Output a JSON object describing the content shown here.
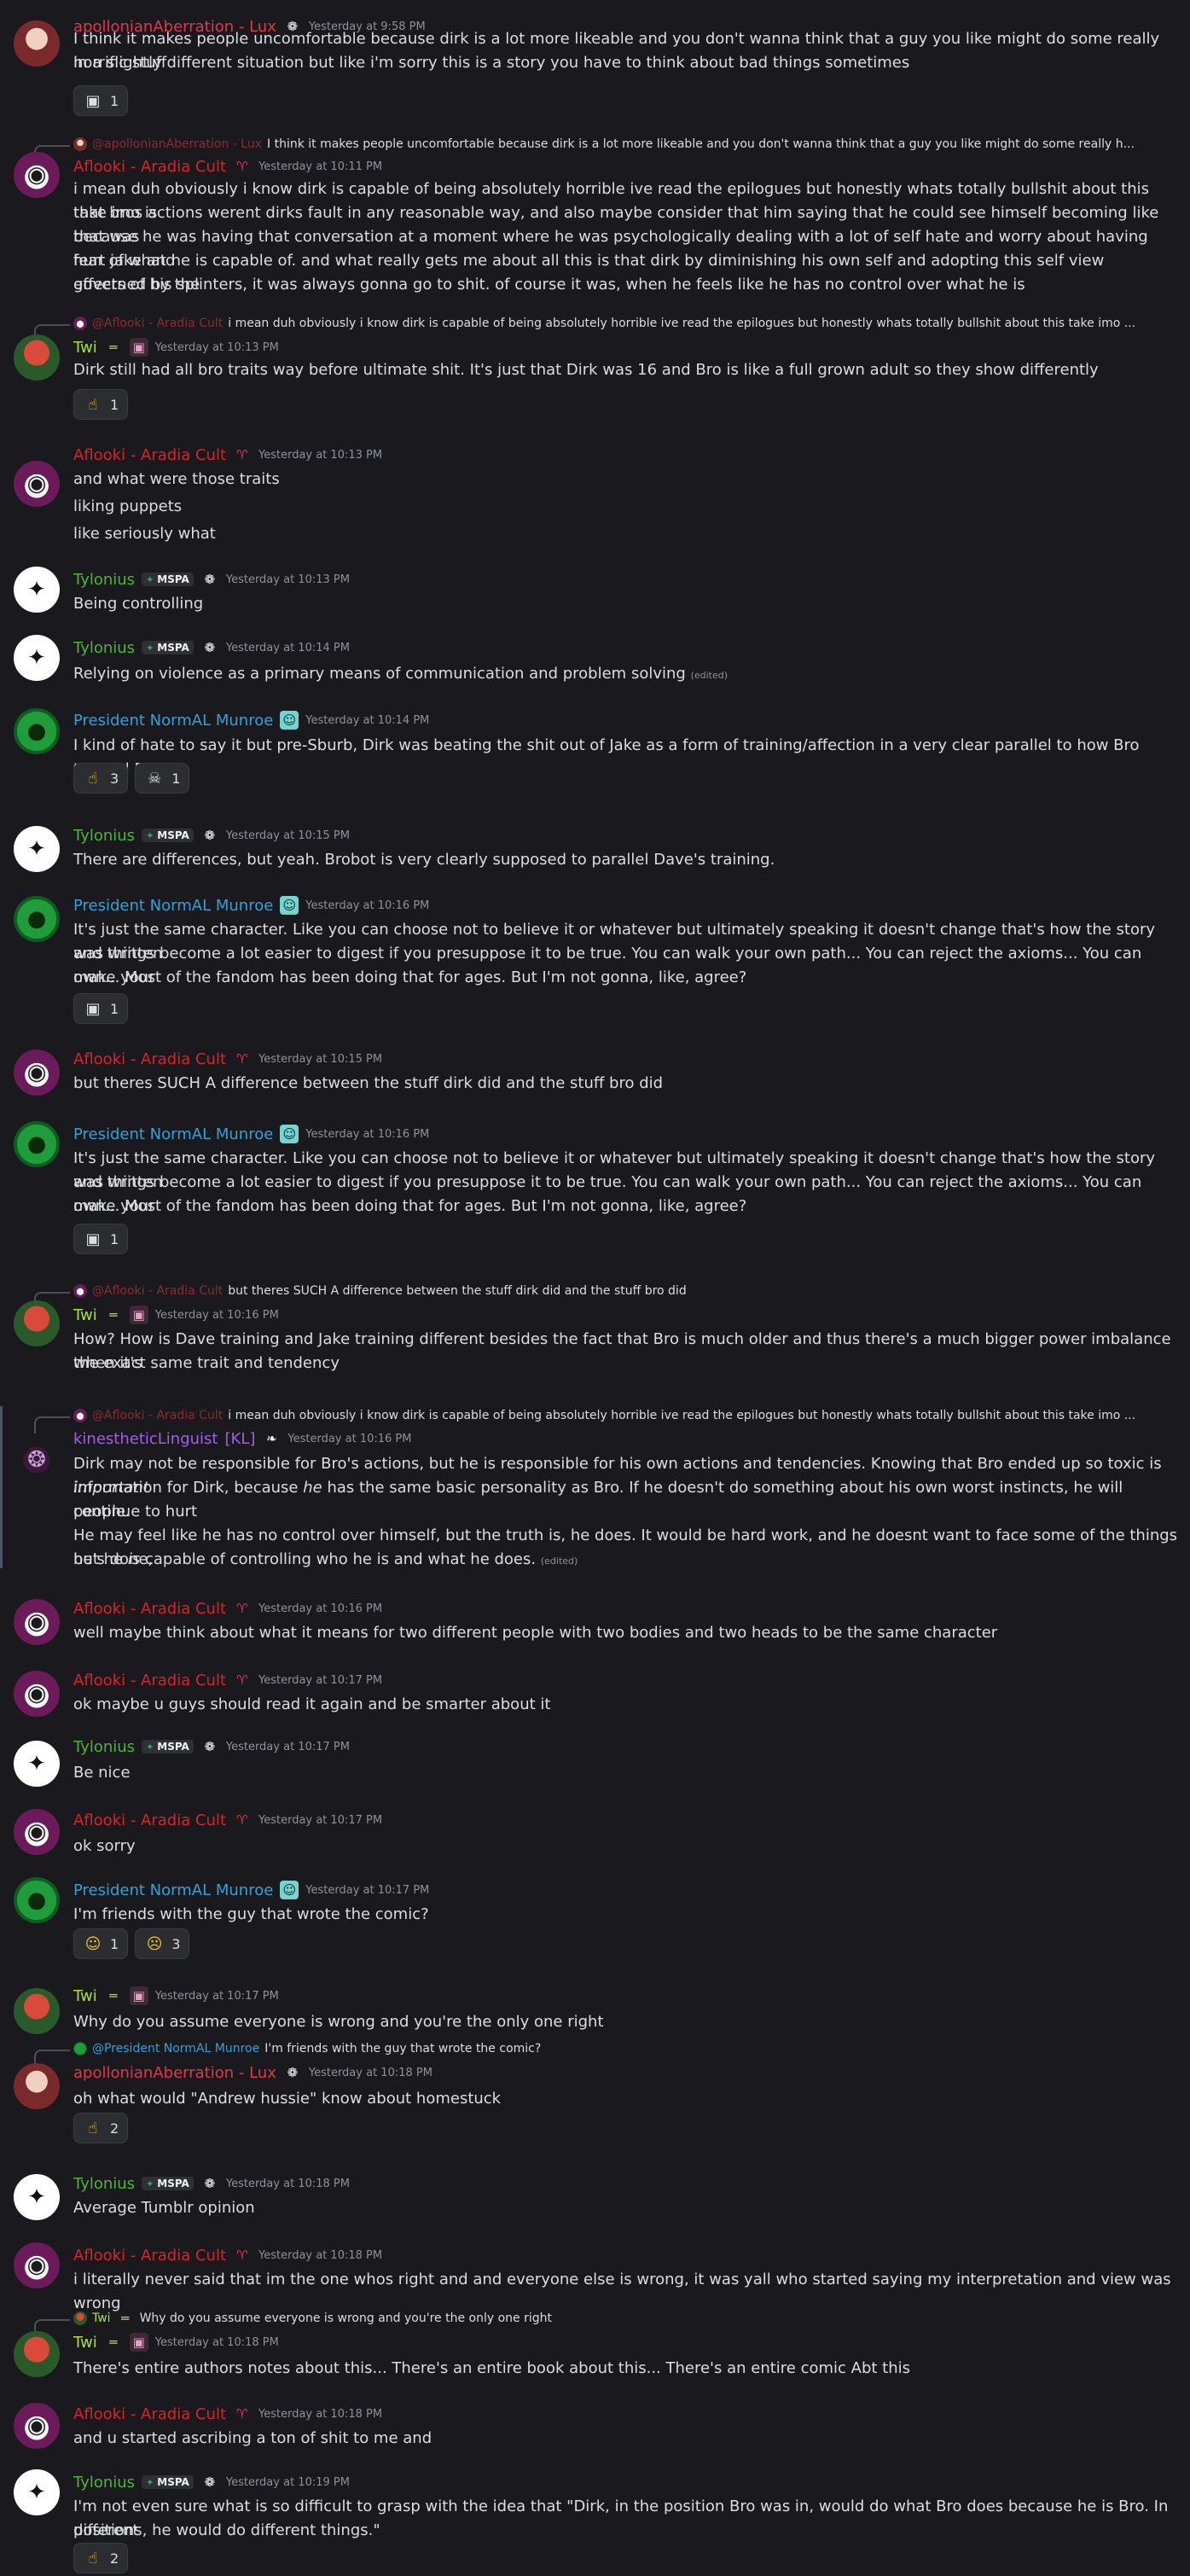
{
  "colors": {
    "lux": "#e0384a",
    "aflooki": "#d8232a",
    "twi": "#a6e13a",
    "tylonius": "#4fb338",
    "norm": "#35a0d8",
    "kinesthetic": "#a45ee8",
    "mention_red": "#8e2a34"
  },
  "badges": {
    "mspa": "MSPA",
    "kl": "[KL]"
  },
  "messages": [
    {
      "user": "apollonianAberration - Lux",
      "ts": "Yesterday at 9:58 PM",
      "lines": [
        "I think it makes people uncomfortable because dirk is a lot more likeable and you don't wanna think that a guy you like might do some really horrific stuff",
        "in a slightly different situation but like i'm sorry this is a story you have to think about bad things sometimes"
      ],
      "reactions": [
        {
          "icon": "sticker-icon",
          "count": "1"
        }
      ]
    },
    {
      "reply_user": "@apollonianAberration - Lux",
      "reply_text": "I think it makes people uncomfortable because dirk is a lot more likeable and you don't wanna think that a guy you like might do some really h...",
      "user": "Aflooki - Aradia Cult",
      "ts": "Yesterday at 10:11 PM",
      "lines": [
        "i mean duh obviously i know dirk is capable of being absolutely horrible ive read the epilogues but honestly whats totally bullshit about this take imo is",
        "that bros actions werent dirks fault in any reasonable way, and also maybe consider that him saying that he could see himself becoming like that was",
        "because he was having that conversation at a moment where he was psychologically dealing with a lot of self hate and worry about having hurt jake and",
        "fear of what he is capable of. and what really gets me about all this is that dirk by diminishing his own self and adopting this self view governed by the",
        "effects of his splinters, it was always gonna go to shit. of course it was, when he feels like he has no control over what he is"
      ]
    },
    {
      "reply_user": "@Aflooki - Aradia Cult",
      "reply_text": "i mean duh obviously i know dirk is capable of being absolutely horrible ive read the epilogues but honestly whats totally bullshit about this take imo ...",
      "user": "Twi",
      "ts": "Yesterday at 10:13 PM",
      "lines": [
        "Dirk still had all bro traits way before ultimate shit. It's just that Dirk was 16 and Bro is like a full grown adult so they show differently"
      ],
      "reactions": [
        {
          "icon": "pointing-up-icon",
          "count": "1"
        }
      ]
    },
    {
      "user": "Aflooki - Aradia Cult",
      "ts": "Yesterday at 10:13 PM",
      "lines": [
        "and what were those traits",
        "liking puppets",
        "like seriously what"
      ]
    },
    {
      "user": "Tylonius",
      "ts": "Yesterday at 10:13 PM",
      "lines": [
        "Being controlling"
      ]
    },
    {
      "user": "Tylonius",
      "ts": "Yesterday at 10:14 PM",
      "lines": [
        "Relying on violence as a primary means of communication and problem solving"
      ],
      "edited": "(edited)"
    },
    {
      "user": "President NormAL Munroe",
      "ts": "Yesterday at 10:14 PM",
      "lines": [
        "I kind of hate to say it but pre-Sburb, Dirk was beating the shit out of Jake as a form of training/affection in a very clear parallel to how Bro treated Dave."
      ],
      "reactions": [
        {
          "icon": "pointing-up-icon",
          "count": "3"
        },
        {
          "icon": "skull-icon",
          "count": "1"
        }
      ]
    },
    {
      "user": "Tylonius",
      "ts": "Yesterday at 10:15 PM",
      "lines": [
        "There are differences, but yeah. Brobot is very clearly supposed to parallel Dave's training."
      ]
    },
    {
      "user": "President NormAL Munroe",
      "ts": "Yesterday at 10:16 PM",
      "lines": [
        "It's just the same character. Like you can choose not to believe it or whatever but ultimately speaking it doesn't change that's how the story was written",
        "and things become a lot easier to digest if you presuppose it to be true. You can walk your own path... You can reject the axioms... You can make your",
        "own... Most of the fandom has been doing that for ages. But I'm not gonna, like, agree?"
      ],
      "reactions": [
        {
          "icon": "sticker-icon",
          "count": "1"
        }
      ]
    },
    {
      "user": "Aflooki - Aradia Cult",
      "ts": "Yesterday at 10:15 PM",
      "lines": [
        "but theres SUCH A difference between the stuff dirk did and the stuff bro did"
      ]
    },
    {
      "user": "President NormAL Munroe",
      "ts": "Yesterday at 10:16 PM",
      "lines": [
        "It's just the same character. Like you can choose not to believe it or whatever but ultimately speaking it doesn't change that's how the story was written",
        "and things become a lot easier to digest if you presuppose it to be true. You can walk your own path... You can reject the axioms... You can make your",
        "own... Most of the fandom has been doing that for ages. But I'm not gonna, like, agree?"
      ],
      "reactions": [
        {
          "icon": "sticker-icon",
          "count": "1"
        }
      ]
    },
    {
      "reply_user": "@Aflooki - Aradia Cult",
      "reply_text": "but theres SUCH A difference between the stuff dirk did and the stuff bro did",
      "user": "Twi",
      "ts": "Yesterday at 10:16 PM",
      "lines": [
        "How? How is Dave training and Jake training different besides the fact that Bro is much older and thus there's a much bigger power imbalance when it's",
        "the exact same trait and tendency"
      ]
    },
    {
      "reply_user": "@Aflooki - Aradia Cult",
      "reply_text": "i mean duh obviously i know dirk is capable of being absolutely horrible ive read the epilogues but honestly whats totally bullshit about this take imo ...",
      "user": "kinestheticLinguist",
      "ts": "Yesterday at 10:16 PM",
      "lines": [
        "Dirk may not be responsible for Bro's actions, but he is responsible for his own actions and tendencies. Knowing that Bro ended up so toxic is",
        "information for Dirk, because",
        "he",
        "has the same basic personality as Bro. If he doesn't do something about his own worst instincts, he will continue to hurt",
        "people.",
        "He may feel like he has no control over himself, but the truth is, he does. It would be hard work, and he doesnt want to face some of the things he's done,",
        "but he",
        "is",
        "capable of controlling who he is and what he does.",
        "important"
      ],
      "edited": "(edited)"
    },
    {
      "user": "Aflooki - Aradia Cult",
      "ts": "Yesterday at 10:16 PM",
      "lines": [
        "well maybe think about what it means for two different people with two bodies and two heads to be the same character"
      ]
    },
    {
      "user": "Aflooki - Aradia Cult",
      "ts": "Yesterday at 10:17 PM",
      "lines": [
        "ok maybe u guys should read it again and be smarter about it"
      ]
    },
    {
      "user": "Tylonius",
      "ts": "Yesterday at 10:17 PM",
      "lines": [
        "Be nice"
      ]
    },
    {
      "user": "Aflooki - Aradia Cult",
      "ts": "Yesterday at 10:17 PM",
      "lines": [
        "ok sorry"
      ]
    },
    {
      "user": "President NormAL Munroe",
      "ts": "Yesterday at 10:17 PM",
      "lines": [
        "I'm friends with the guy that wrote the comic?"
      ],
      "reactions": [
        {
          "icon": "smirk-cat-icon",
          "count": "1"
        },
        {
          "icon": "crying-face-icon",
          "count": "3"
        }
      ]
    },
    {
      "user": "Twi",
      "ts": "Yesterday at 10:17 PM",
      "lines": [
        "Why do you assume everyone is wrong and you're the only one right"
      ]
    },
    {
      "reply_user": "@President NormAL Munroe",
      "reply_text": "I'm friends with the guy that wrote the comic?",
      "user": "apollonianAberration - Lux",
      "ts": "Yesterday at 10:18 PM",
      "lines": [
        "oh what would \"Andrew hussie\" know about homestuck"
      ],
      "reactions": [
        {
          "icon": "pointing-up-icon",
          "count": "2"
        }
      ]
    },
    {
      "user": "Tylonius",
      "ts": "Yesterday at 10:18 PM",
      "lines": [
        "Average Tumblr opinion"
      ]
    },
    {
      "user": "Aflooki - Aradia Cult",
      "ts": "Yesterday at 10:18 PM",
      "lines": [
        "i literally never said that im the one whos right and and everyone else is wrong, it was yall who started saying my interpretation and view was wrong"
      ]
    },
    {
      "reply_user": "Twi",
      "reply_text": "Why do you assume everyone is wrong and you're the only one right",
      "user": "Twi",
      "ts": "Yesterday at 10:18 PM",
      "lines": [
        "There's entire authors notes about this... There's an entire book about this... There's an entire comic Abt this"
      ]
    },
    {
      "user": "Aflooki - Aradia Cult",
      "ts": "Yesterday at 10:18 PM",
      "lines": [
        "and u started ascribing a ton of shit to me and"
      ]
    },
    {
      "user": "Tylonius",
      "ts": "Yesterday at 10:19 PM",
      "lines": [
        "I'm not even sure what is so difficult to grasp with the idea that \"Dirk, in the position Bro was in, would do what Bro does because he is Bro. In different",
        "positions, he would do different things.\""
      ],
      "reactions": [
        {
          "icon": "pointing-up-icon",
          "count": "2"
        }
      ]
    }
  ]
}
